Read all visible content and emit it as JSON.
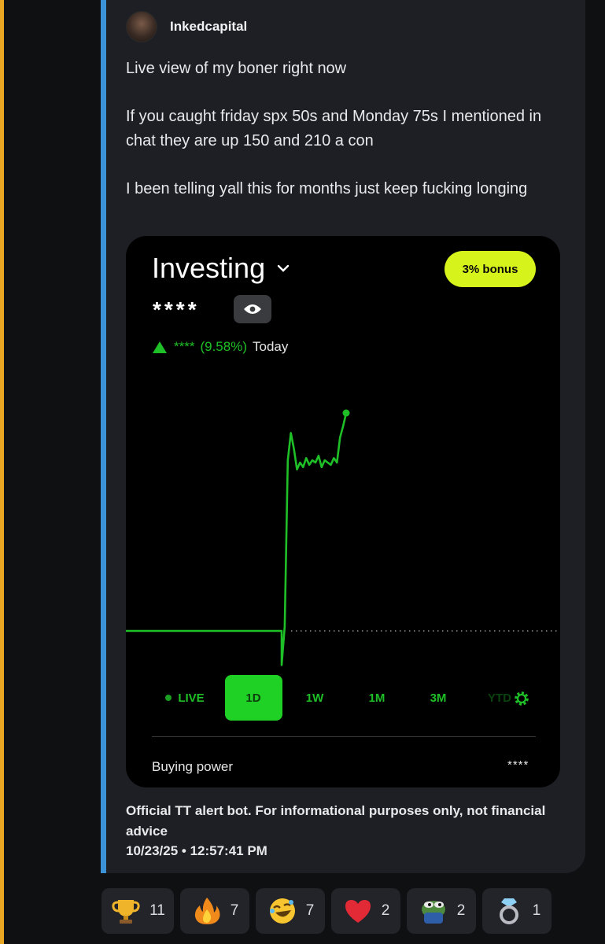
{
  "author": {
    "name": "Inkedcapital"
  },
  "message": {
    "paragraphs": [
      "Live view of my boner right now",
      "If you caught friday spx 50s and Monday 75s I mentioned in chat they are up 150 and 210 a con",
      "I been telling yall this for months just keep fucking longing"
    ]
  },
  "card": {
    "title": "Investing",
    "bonus_label": "3% bonus",
    "balance": "****",
    "change_amount": "****",
    "change_pct": "(9.58%)",
    "change_period": "Today",
    "ranges": [
      "LIVE",
      "1D",
      "1W",
      "1M",
      "3M",
      "YTD"
    ],
    "active_range": "1D",
    "buying_power_label": "Buying power",
    "buying_power_value": "****",
    "accent_color": "#1fbf27",
    "bonus_color": "#d7f31c"
  },
  "chart_data": {
    "type": "line",
    "title": "",
    "xlabel": "",
    "ylabel": "",
    "grid": false,
    "baseline_dotted": true,
    "series": [
      {
        "values": [
          0,
          0,
          0,
          0,
          0,
          0,
          0,
          0,
          0,
          0,
          0,
          0,
          0,
          0,
          0,
          -1.5,
          0.2,
          7.5,
          8.7,
          8.0,
          7.1,
          7.4,
          7.2,
          7.6,
          7.3,
          7.5,
          7.4,
          7.7,
          7.2,
          7.5,
          7.4,
          7.3,
          7.6,
          7.4,
          8.5,
          9.0,
          9.58
        ]
      }
    ]
  },
  "footer": {
    "disclaimer": "Official TT alert bot. For informational purposes only, not financial advice",
    "timestamp": "10/23/25 • 12:57:41 PM"
  },
  "reactions": [
    {
      "icon": "trophy-icon",
      "count": "11"
    },
    {
      "icon": "fire-icon",
      "count": "7"
    },
    {
      "icon": "laughing-face-icon",
      "count": "7"
    },
    {
      "icon": "heart-icon",
      "count": "2"
    },
    {
      "icon": "pepe-frog-icon",
      "count": "2"
    },
    {
      "icon": "ring-icon",
      "count": "1"
    }
  ]
}
